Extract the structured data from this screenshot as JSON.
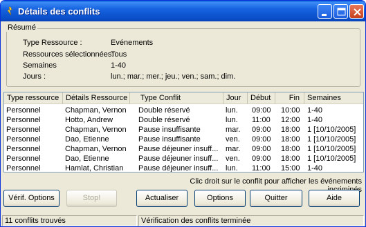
{
  "window": {
    "title": "Détails des conflits"
  },
  "summary": {
    "legend": "Résumé",
    "rows": [
      {
        "label": "Type Ressource :",
        "value": "Evénements"
      },
      {
        "label": "Ressources sélectionnées:",
        "value": "Tous"
      },
      {
        "label": "Semaines",
        "value": "1-40"
      },
      {
        "label": "Jours :",
        "value": "lun.; mar.; mer.; jeu.; ven.; sam.; dim."
      }
    ]
  },
  "table": {
    "headers": [
      "Type ressource",
      "Détails Ressource",
      "Type Conflit",
      "Jour",
      "Début",
      "Fin",
      "Semaines"
    ],
    "rows": [
      [
        "Personnel",
        "Chapman, Vernon",
        "Double réservé",
        "lun.",
        "09:00",
        "10:00",
        "1-40"
      ],
      [
        "Personnel",
        "Hotto, Andrew",
        "Double réservé",
        "lun.",
        "11:00",
        "12:00",
        "1-40"
      ],
      [
        "Personnel",
        "Chapman, Vernon",
        "Pause insuffisante",
        "mar.",
        "09:00",
        "18:00",
        "1 [10/10/2005]"
      ],
      [
        "Personnel",
        "Dao, Etienne",
        "Pause insuffisante",
        "ven.",
        "09:00",
        "18:00",
        "1 [10/10/2005]"
      ],
      [
        "Personnel",
        "Chapman, Vernon",
        "Pause déjeuner insuff...",
        "mar.",
        "09:00",
        "18:00",
        "1 [10/10/2005]"
      ],
      [
        "Personnel",
        "Dao, Etienne",
        "Pause déjeuner insuff...",
        "ven.",
        "09:00",
        "18:00",
        "1 [10/10/2005]"
      ],
      [
        "Personnel",
        "Hamlat, Christian",
        "Pause déjeuner insuff...",
        "lun.",
        "11:00",
        "15:00",
        "1-40"
      ]
    ]
  },
  "hint": "Clic droit sur le conflit pour afficher les événements incriminés",
  "buttons": {
    "verif": "Vérif. Options",
    "stop": "Stop!",
    "refresh": "Actualiser",
    "options": "Options",
    "quit": "Quitter",
    "help": "Aide"
  },
  "status": {
    "count": "11 conflits trouvés",
    "message": "Vérification des conflits terminée"
  },
  "colors": {
    "titlebar": "#0a4fc8",
    "close": "#c8401d"
  },
  "icons": [
    "app-icon",
    "minimize-icon",
    "maximize-icon",
    "close-icon"
  ]
}
